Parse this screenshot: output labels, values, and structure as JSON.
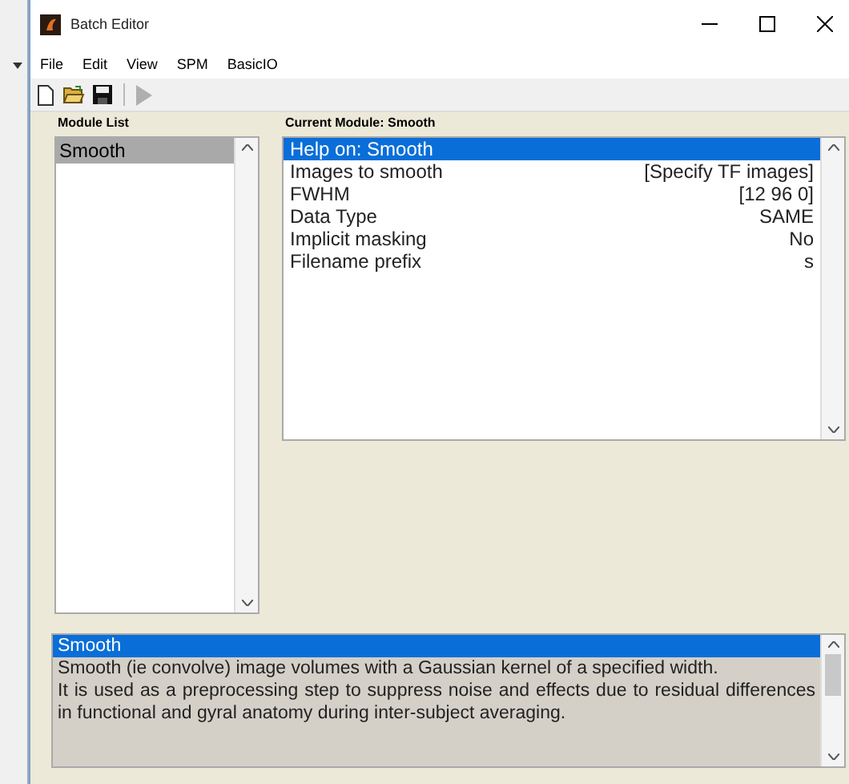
{
  "window": {
    "title": "Batch Editor"
  },
  "menu": [
    "File",
    "Edit",
    "View",
    "SPM",
    "BasicIO"
  ],
  "toolbar": [
    {
      "kind": "new"
    },
    {
      "kind": "open"
    },
    {
      "kind": "save"
    },
    {
      "kind": "run",
      "disabled": true
    }
  ],
  "module_list": {
    "heading": "Module List",
    "items": [
      {
        "label": "Smooth",
        "selected": true
      }
    ]
  },
  "current_module": {
    "heading": "Current Module: Smooth",
    "items": [
      {
        "label": "Help on: Smooth",
        "selected": true
      },
      {
        "label": "Images to smooth",
        "value": "[Specify TF images]",
        "selected": false
      },
      {
        "label": "FWHM",
        "value": "[12 96 0]",
        "selected": false
      },
      {
        "label": "Data Type",
        "value": "SAME",
        "selected": false
      },
      {
        "label": "Implicit masking",
        "value": "No",
        "selected": false
      },
      {
        "label": "Filename prefix",
        "value": "s",
        "selected": false
      }
    ]
  },
  "help": {
    "items": [
      {
        "text": "Smooth",
        "selected": true
      },
      {
        "text": "Smooth (ie convolve) image volumes with a Gaussian kernel of a specified width.",
        "selected": false
      },
      {
        "text": "It is used as a preprocessing step to suppress noise and effects due to residual differences in functional and gyral anatomy during inter-subject averaging.",
        "selected": false
      }
    ]
  }
}
